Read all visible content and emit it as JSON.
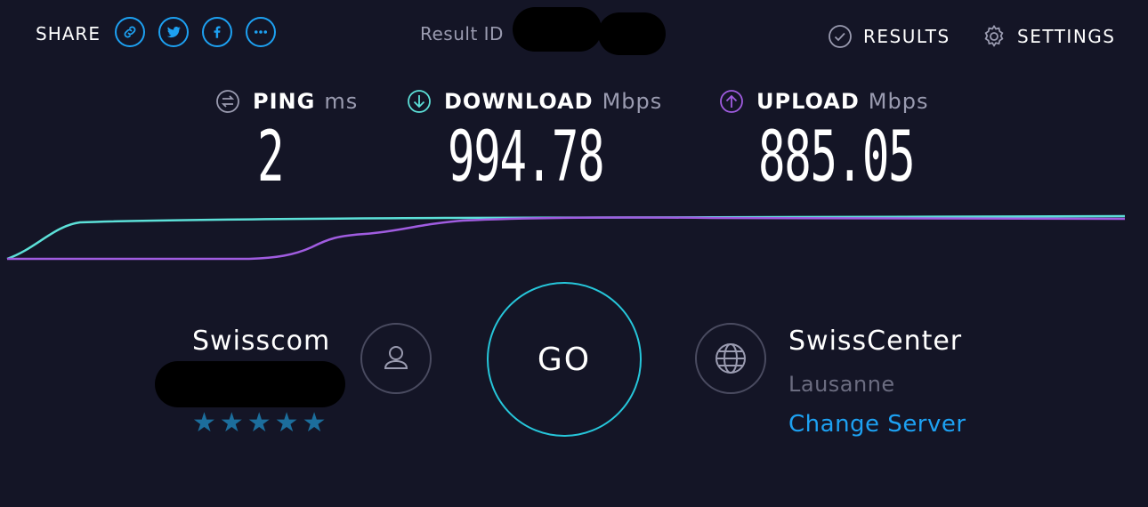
{
  "share": {
    "label": "SHARE",
    "buttons": [
      {
        "icon": "link-icon"
      },
      {
        "icon": "twitter-icon"
      },
      {
        "icon": "facebook-icon"
      },
      {
        "icon": "more-icon"
      }
    ]
  },
  "result": {
    "label": "Result ID"
  },
  "nav": {
    "results_label": "RESULTS",
    "settings_label": "SETTINGS"
  },
  "metrics": {
    "ping": {
      "name": "PING",
      "unit": "ms",
      "value": "2",
      "icon": "ping-icon"
    },
    "download": {
      "name": "DOWNLOAD",
      "unit": "Mbps",
      "value": "994.78",
      "icon": "download-arrow-icon"
    },
    "upload": {
      "name": "UPLOAD",
      "unit": "Mbps",
      "value": "885.05",
      "icon": "upload-arrow-icon"
    }
  },
  "isp": {
    "name": "Swisscom",
    "rating_stars": "★★★★★",
    "icon": "user-icon"
  },
  "go_label": "GO",
  "server": {
    "name": "SwissCenter",
    "location": "Lausanne",
    "change_label": "Change Server",
    "icon": "globe-icon"
  },
  "colors": {
    "background": "#141526",
    "accent_blue": "#1da1f2",
    "download": "#5ce0d8",
    "upload": "#a05ce0",
    "go_ring": "#26c6da"
  }
}
